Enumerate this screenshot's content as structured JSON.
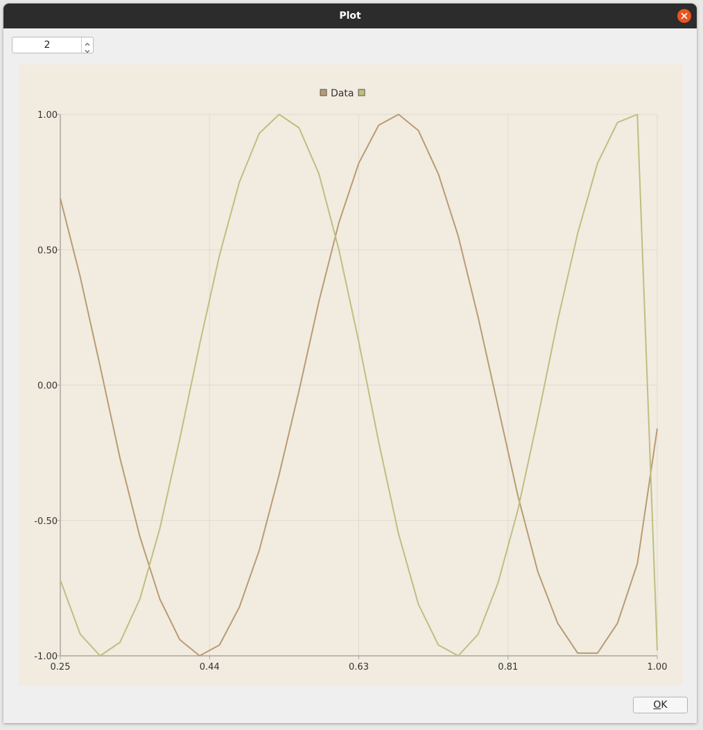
{
  "window": {
    "title": "Plot"
  },
  "controls": {
    "spin_value": "2",
    "ok_label_mnemonic": "O",
    "ok_label_rest": "K"
  },
  "icons": {
    "close": "close-icon",
    "up": "chevron-up-icon",
    "down": "chevron-down-icon"
  },
  "colors": {
    "titlebar": "#2c2c2c",
    "close_button": "#e95420",
    "chart_background": "#f2ebe0",
    "grid": "#dedad2",
    "axis": "#a8a8a0",
    "series_1": "#b89b72",
    "series_2": "#bdbf7f"
  },
  "chart_data": {
    "type": "line",
    "title": "",
    "xlabel": "",
    "ylabel": "",
    "xlim": [
      0.25,
      1.0
    ],
    "ylim": [
      -1.0,
      1.0
    ],
    "x_ticks": [
      "0.25",
      "0.44",
      "0.63",
      "0.81",
      "1.00"
    ],
    "y_ticks": [
      "1.00",
      "0.50",
      "0.00",
      "-0.50",
      "-1.00"
    ],
    "grid": true,
    "legend_position": "top-center",
    "series": [
      {
        "name": "Data",
        "color": "#b89b72",
        "x": [
          0.25,
          0.275,
          0.3,
          0.325,
          0.35,
          0.375,
          0.4,
          0.425,
          0.45,
          0.475,
          0.5,
          0.525,
          0.55,
          0.575,
          0.6,
          0.625,
          0.65,
          0.675,
          0.7,
          0.725,
          0.75,
          0.775,
          0.8,
          0.825,
          0.85,
          0.875,
          0.9,
          0.925,
          0.95,
          0.975,
          1.0
        ],
        "y": [
          0.69,
          0.4,
          0.07,
          -0.27,
          -0.56,
          -0.79,
          -0.94,
          -1.0,
          -0.96,
          -0.82,
          -0.61,
          -0.33,
          -0.02,
          0.31,
          0.6,
          0.82,
          0.96,
          1.0,
          0.94,
          0.78,
          0.55,
          0.25,
          -0.08,
          -0.41,
          -0.69,
          -0.88,
          -0.99,
          -0.99,
          -0.88,
          -0.66,
          -0.16
        ]
      },
      {
        "color": "#bdbf7f",
        "x": [
          0.25,
          0.275,
          0.3,
          0.325,
          0.35,
          0.375,
          0.4,
          0.425,
          0.45,
          0.475,
          0.5,
          0.525,
          0.55,
          0.575,
          0.6,
          0.625,
          0.65,
          0.675,
          0.7,
          0.725,
          0.75,
          0.775,
          0.8,
          0.825,
          0.85,
          0.875,
          0.9,
          0.925,
          0.95,
          0.975,
          1.0
        ],
        "y": [
          -0.72,
          -0.92,
          -1.0,
          -0.95,
          -0.79,
          -0.53,
          -0.2,
          0.15,
          0.48,
          0.75,
          0.93,
          1.0,
          0.95,
          0.78,
          0.5,
          0.16,
          -0.21,
          -0.55,
          -0.81,
          -0.96,
          -1.0,
          -0.92,
          -0.73,
          -0.46,
          -0.12,
          0.24,
          0.56,
          0.82,
          0.97,
          1.0,
          -0.98
        ]
      }
    ]
  }
}
